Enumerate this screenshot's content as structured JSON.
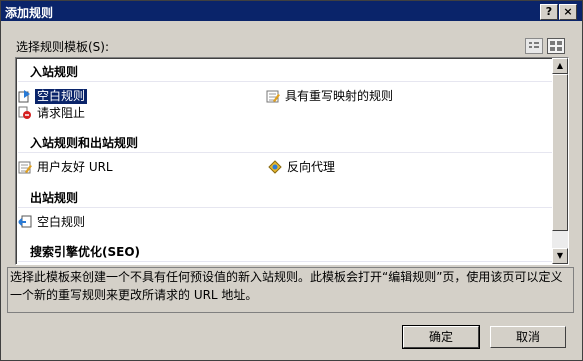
{
  "window": {
    "title": "添加规则",
    "help_label": "?",
    "close_label": "×"
  },
  "template_label": "选择规则模板(S):",
  "groups": [
    {
      "title": "入站规则",
      "items": [
        {
          "label": "空白规则",
          "icon": "blank-inbound-rule-icon",
          "selected": true
        },
        {
          "label": "具有重写映射的规则",
          "icon": "rewrite-map-rule-icon"
        },
        {
          "label": "请求阻止",
          "icon": "request-blocking-icon"
        }
      ]
    },
    {
      "title": "入站规则和出站规则",
      "items": [
        {
          "label": "用户友好 URL",
          "icon": "user-friendly-url-icon"
        },
        {
          "label": "反向代理",
          "icon": "reverse-proxy-icon"
        }
      ]
    },
    {
      "title": "出站规则",
      "items": [
        {
          "label": "空白规则",
          "icon": "blank-outbound-rule-icon"
        }
      ]
    },
    {
      "title": "搜索引擎优化(SEO)",
      "items": []
    }
  ],
  "description": "选择此模板来创建一个不具有任何预设值的新入站规则。此模板会打开“编辑规则”页，使用该页可以定义一个新的重写规则来更改所请求的 URL 地址。",
  "buttons": {
    "ok": "确定",
    "cancel": "取消"
  },
  "colors": {
    "titlebar": "#0a246a",
    "dialog_bg": "#d4d0c8",
    "selection": "#0a246a"
  }
}
